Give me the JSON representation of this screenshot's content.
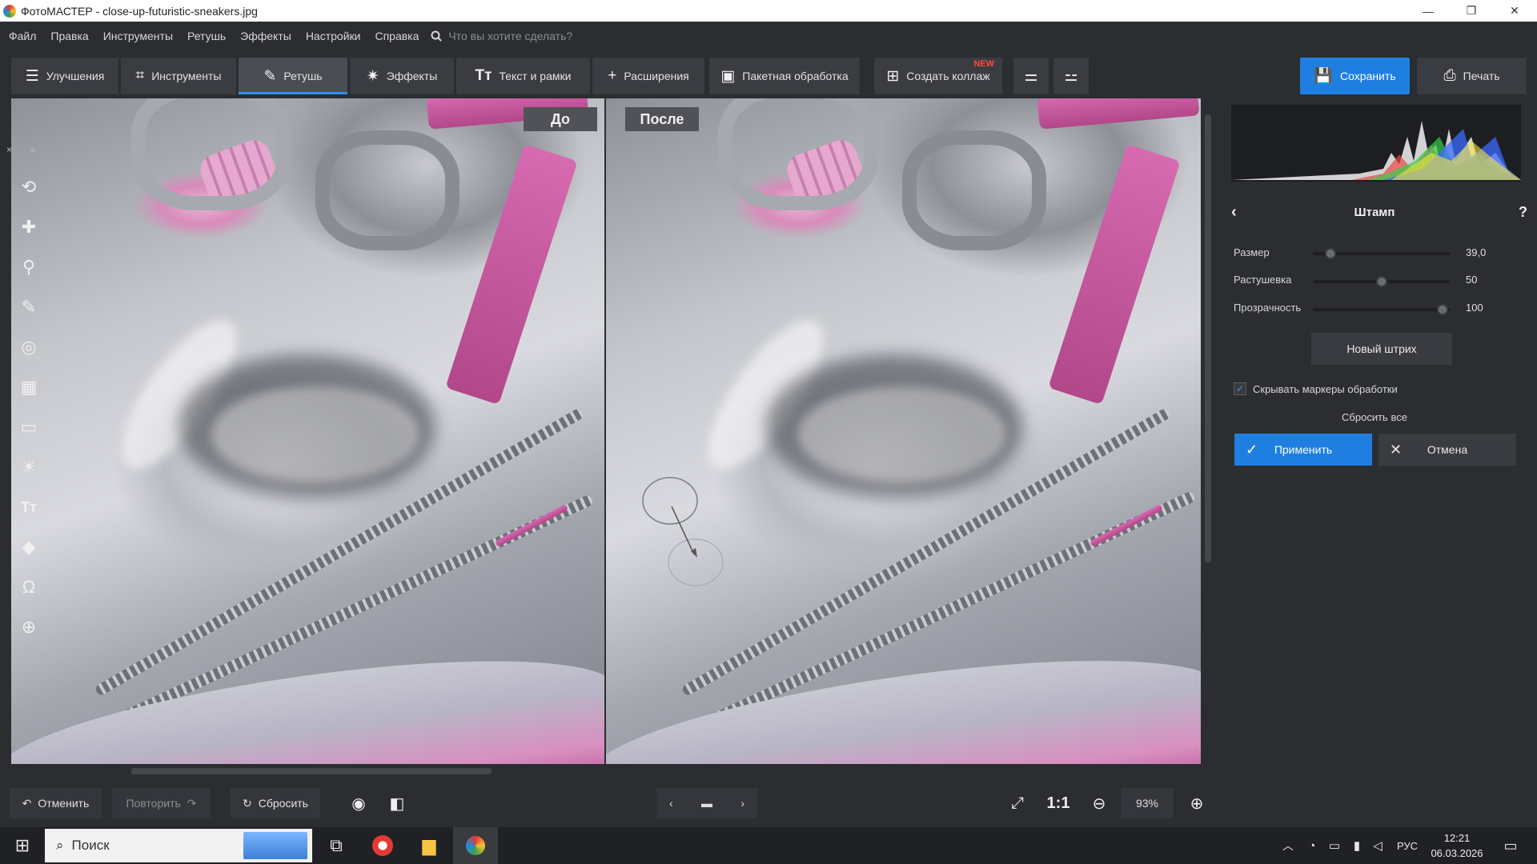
{
  "window": {
    "title": "ФотоМАСТЕР - close-up-futuristic-sneakers.jpg",
    "controls": [
      "—",
      "❐",
      "✕"
    ]
  },
  "menu": {
    "items": [
      "Файл",
      "Правка",
      "Инструменты",
      "Ретушь",
      "Эффекты",
      "Настройки",
      "Справка"
    ],
    "search_placeholder": "Что вы хотите сделать?"
  },
  "toolbar": {
    "tabs": [
      {
        "label": "Улучшения",
        "icon": "sliders-icon"
      },
      {
        "label": "Инструменты",
        "icon": "crop-icon"
      },
      {
        "label": "Ретушь",
        "icon": "brush-icon",
        "active": true
      },
      {
        "label": "Эффекты",
        "icon": "sparkle-icon"
      },
      {
        "label": "Текст и рамки",
        "icon": "text-icon"
      },
      {
        "label": "Расширения",
        "icon": "plus-icon"
      },
      {
        "label": "Пакетная обработка",
        "icon": "batch-icon"
      },
      {
        "label": "Создать коллаж",
        "icon": "collage-icon",
        "badge": "NEW"
      }
    ],
    "save_label": "Сохранить",
    "print_label": "Печать",
    "accent_color": "#1f7fe0"
  },
  "canvas": {
    "before_label": "До",
    "after_label": "После"
  },
  "tool_palette": {
    "header_close": "×",
    "header_collapse": "«",
    "tools": [
      "rotate-icon",
      "patch-icon",
      "stamp-icon",
      "brush-icon",
      "radial-icon",
      "gradient-icon",
      "vignette-icon",
      "sun-icon",
      "text-icon",
      "fill-icon",
      "lasso-icon",
      "globe-icon"
    ]
  },
  "bottom": {
    "undo_label": "Отменить",
    "redo_label": "Повторить",
    "reset_label": "Сбросить",
    "zoom_one": "1:1",
    "zoom_value": "93%"
  },
  "panel": {
    "title": "Штамп",
    "help": "?",
    "sliders": [
      {
        "label": "Размер",
        "value": "39,0",
        "fraction": 0.13
      },
      {
        "label": "Растушевка",
        "value": "50",
        "fraction": 0.5
      },
      {
        "label": "Прозрачность",
        "value": "100",
        "fraction": 0.94
      }
    ],
    "new_stroke_label": "Новый штрих",
    "hide_markers_label": "Скрывать маркеры обработки",
    "hide_markers_checked": true,
    "reset_all_label": "Сбросить все",
    "apply_label": "Применить",
    "cancel_label": "Отмена"
  },
  "taskbar": {
    "search_label": "Поиск",
    "lang": "РУС",
    "time": "12:21",
    "date": "06.03.2026"
  }
}
